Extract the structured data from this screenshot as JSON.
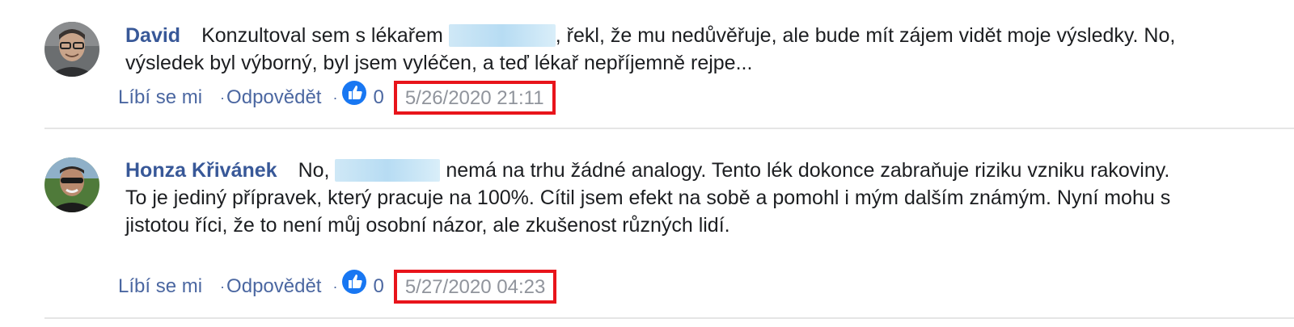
{
  "comments": [
    {
      "author": "David",
      "text_before": "Konzultoval sem s lékařem ",
      "text_after": ", řekl, že mu nedůvěřuje, ale bude mít zájem vidět moje výsledky. No, výsledek byl výborný, byl jsem vyléčen, a teď lékař nepříjemně rejpe...",
      "like_label": "Líbí se mi",
      "reply_label": "Odpovědět",
      "like_count": "0",
      "timestamp": "5/26/2020 21:11"
    },
    {
      "author": "Honza Křivánek",
      "text_before": "No, ",
      "text_after": " nemá na trhu žádné analogy. Tento lék dokonce zabraňuje riziku vzniku rakoviny. To je jediný přípravek, který pracuje na 100%. Cítil jsem efekt na sobě a pomohl i mým dalším známým. Nyní mohu s jistotou říci, že to není můj osobní názor, ale zkušenost různých lidí.",
      "like_label": "Líbí se mi",
      "reply_label": "Odpovědět",
      "like_count": "0",
      "timestamp": "5/27/2020 04:23"
    }
  ],
  "colors": {
    "author": "#385898",
    "link": "#4b67a1",
    "timestamp": "#90949c",
    "highlight_box": "#e8141b",
    "like_badge": "#1877f2"
  },
  "icons": [
    "avatar-david",
    "avatar-honza",
    "thumbs-up-icon"
  ]
}
